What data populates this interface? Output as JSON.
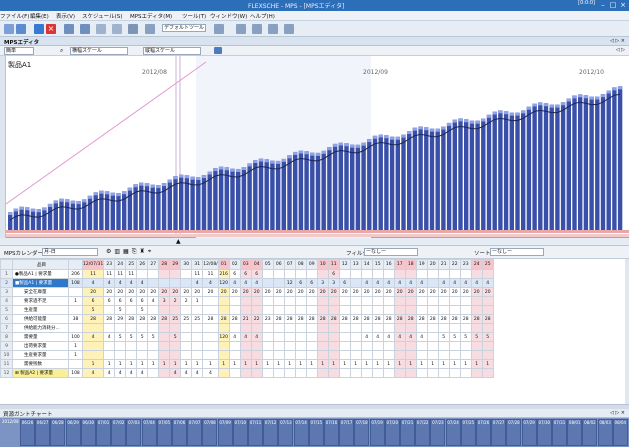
{
  "window": {
    "title": "FLEXSCHE - MPS - [MPSエディタ]",
    "clock": "[0:0:0]"
  },
  "menu": [
    "ファイル(F)",
    "編集(E)",
    "表示(V)",
    "スケジュール(S)",
    "MPSエディタ(M)",
    "ツール(T)",
    "ウィンドウ(W)",
    "ヘルプ(H)"
  ],
  "toolbar": {
    "tool_dropdown": "デフォルトツール"
  },
  "panel": {
    "title": "MPSエディタ"
  },
  "controls": {
    "mode": "簡単",
    "scale_input": "横幅スケール",
    "scale_output": "縦幅スケール"
  },
  "chart_data": {
    "type": "bar",
    "title": "製品A1",
    "month_labels": [
      "2012/08",
      "2012/09",
      "2012/10"
    ],
    "note": "cumulative bars rising steadily across ~110 days with a darker line overlaid"
  },
  "grid": {
    "calendar_label": "MPSカレンダー",
    "calendar_value": "月-日",
    "filter_label": "フィルタ",
    "filter_value": "ーなしー",
    "sort_label": "ソート",
    "sort_value": "ーなしー",
    "header_item": "品目",
    "dates": [
      "12/07/31",
      "23",
      "24",
      "25",
      "26",
      "27",
      "28",
      "29",
      "30",
      "31",
      "12/08/",
      "01",
      "02",
      "03",
      "04",
      "05",
      "06",
      "07",
      "08",
      "09",
      "10",
      "11",
      "12",
      "13",
      "14",
      "15",
      "16",
      "17",
      "18",
      "19",
      "20",
      "21",
      "22",
      "23",
      "24",
      "25"
    ],
    "rows": [
      {
        "n": "1",
        "label": "●製品A1 | 要求量",
        "tot": "206",
        "cells": [
          "11",
          "11",
          "11",
          "11",
          "",
          "",
          "",
          "",
          "",
          "11",
          "11",
          "216",
          "6",
          "6",
          "6",
          "",
          "",
          "",
          "",
          "",
          "",
          "6",
          "",
          "",
          "",
          "",
          "",
          "",
          "",
          "",
          "",
          "",
          "",
          "",
          ""
        ]
      },
      {
        "n": "2",
        "label": "■製品A1 | 要求量",
        "tot": "108",
        "cells": [
          "4",
          "4",
          "4",
          "4",
          "4",
          "",
          "",
          "",
          "",
          "4",
          "4",
          "120",
          "4",
          "4",
          "4",
          "",
          "",
          "12",
          "6",
          "6",
          "3",
          "3",
          "6",
          "",
          "4",
          "4",
          "4",
          "4",
          "4",
          "4",
          "",
          "4",
          "4",
          "4",
          "4",
          "4"
        ]
      },
      {
        "n": "3",
        "label": "　　安全在庫量",
        "tot": "",
        "cells": [
          "20",
          "20",
          "20",
          "20",
          "20",
          "20",
          "20",
          "20",
          "20",
          "20",
          "20",
          "20",
          "20",
          "20",
          "20",
          "20",
          "20",
          "20",
          "20",
          "20",
          "20",
          "20",
          "20",
          "20",
          "20",
          "20",
          "20",
          "20",
          "20",
          "20",
          "20",
          "20",
          "20",
          "20",
          "20",
          "20"
        ]
      },
      {
        "n": "4",
        "label": "　　要求過不足",
        "tot": "1",
        "cells": [
          "6",
          "6",
          "6",
          "6",
          "6",
          "4",
          "3",
          "2",
          "2",
          "1",
          "",
          "",
          "",
          "",
          "",
          "",
          "",
          "",
          "",
          "",
          "",
          "",
          "",
          "",
          "",
          "",
          "",
          "",
          "",
          "",
          "",
          "",
          "",
          "",
          "",
          ""
        ]
      },
      {
        "n": "5",
        "label": "　　生産量",
        "tot": "",
        "cells": [
          "5",
          "",
          "5",
          "",
          "5",
          "",
          "",
          "",
          "",
          "",
          "",
          "",
          "",
          "",
          "",
          "",
          "",
          "",
          "",
          "",
          "",
          "",
          "",
          "",
          "",
          "",
          "",
          "",
          "",
          "",
          "",
          "",
          "",
          "",
          "",
          ""
        ]
      },
      {
        "n": "6",
        "label": "　　供給可能量",
        "tot": "38",
        "cells": [
          "28",
          "28",
          "29",
          "28",
          "28",
          "28",
          "28",
          "25",
          "25",
          "25",
          "28",
          "28",
          "28",
          "21",
          "22",
          "23",
          "28",
          "28",
          "28",
          "28",
          "28",
          "28",
          "28",
          "28",
          "28",
          "28",
          "28",
          "28",
          "28",
          "28",
          "28",
          "28",
          "28",
          "28",
          "28",
          "28"
        ]
      },
      {
        "n": "7",
        "label": "　　供給能力消耗分...",
        "tot": "",
        "cells": [
          "",
          "",
          "",
          "",
          "",
          "",
          "",
          "",
          "",
          "",
          "",
          "",
          "",
          "",
          "",
          "",
          "",
          "",
          "",
          "",
          "",
          "",
          "",
          "",
          "",
          "",
          "",
          "",
          "",
          "",
          "",
          "",
          "",
          "",
          "",
          ""
        ]
      },
      {
        "n": "8",
        "label": "　　需要量",
        "tot": "100",
        "cells": [
          "4",
          "4",
          "5",
          "5",
          "5",
          "5",
          "",
          "5",
          "",
          "",
          "",
          "120",
          "4",
          "4",
          "4",
          "",
          "",
          "",
          "",
          "",
          "",
          "",
          "",
          "",
          "4",
          "4",
          "4",
          "4",
          "4",
          "4",
          "",
          "5",
          "5",
          "5",
          "5",
          "5"
        ]
      },
      {
        "n": "9",
        "label": "　　出荷要求量",
        "tot": "1",
        "cells": [
          "",
          "",
          "",
          "",
          "",
          "",
          "",
          "",
          "",
          "",
          "",
          "",
          "",
          "",
          "",
          "",
          "",
          "",
          "",
          "",
          "",
          "",
          "",
          "",
          "",
          "",
          "",
          "",
          "",
          "",
          "",
          "",
          "",
          "",
          "",
          ""
        ]
      },
      {
        "n": "10",
        "label": "　　生産要求量",
        "tot": "1",
        "cells": [
          "",
          "",
          "",
          "",
          "",
          "",
          "",
          "",
          "",
          "",
          "",
          "",
          "",
          "",
          "",
          "",
          "",
          "",
          "",
          "",
          "",
          "",
          "",
          "",
          "",
          "",
          "",
          "",
          "",
          "",
          "",
          "",
          "",
          "",
          "",
          ""
        ]
      },
      {
        "n": "11",
        "label": "　　需要残数",
        "tot": "",
        "cells": [
          "1",
          "1",
          "1",
          "1",
          "1",
          "1",
          "1",
          "1",
          "1",
          "1",
          "1",
          "1",
          "1",
          "1",
          "1",
          "1",
          "1",
          "1",
          "1",
          "1",
          "1",
          "1",
          "1",
          "1",
          "1",
          "1",
          "1",
          "1",
          "1",
          "1",
          "1",
          "1",
          "1",
          "1",
          "1",
          "1"
        ]
      },
      {
        "n": "12",
        "label": "⊞ 製品A2 | 要求量",
        "tot": "108",
        "cells": [
          "4",
          "4",
          "4",
          "4",
          "4",
          "",
          "",
          "4",
          "4",
          "4",
          "4",
          "",
          "",
          "",
          "",
          "",
          "",
          "",
          "",
          "",
          "",
          "",
          "",
          "",
          "",
          "",
          "",
          "",
          "",
          "",
          "",
          "",
          "",
          "",
          "",
          ""
        ]
      }
    ]
  },
  "bottom": {
    "tab": "資源ガントチャート",
    "month": "2012/08"
  },
  "gantt": [
    "06/26",
    "06/27",
    "06/28",
    "06/29",
    "06/30",
    "07/01",
    "07/02",
    "07/03",
    "07/04",
    "07/05",
    "07/06",
    "07/07",
    "07/08",
    "07/09",
    "07/10",
    "07/11",
    "07/12",
    "07/13",
    "07/14",
    "07/15",
    "07/16",
    "07/17",
    "07/18",
    "07/19",
    "07/20",
    "07/21",
    "07/22",
    "07/23",
    "07/24",
    "07/25",
    "07/26",
    "07/27",
    "07/28",
    "07/29",
    "07/30",
    "07/31",
    "08/01",
    "08/02",
    "08/03",
    "08/04"
  ]
}
